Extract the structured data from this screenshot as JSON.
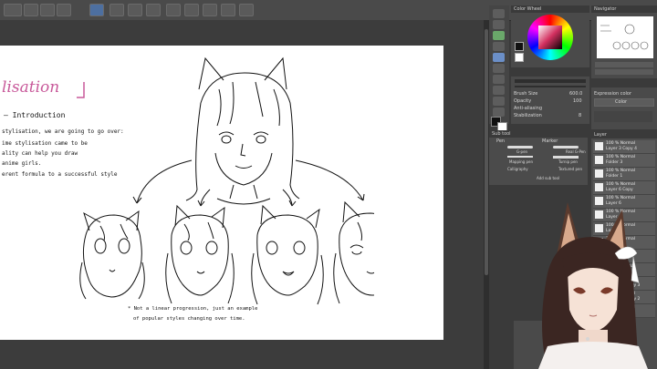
{
  "canvas": {
    "title_fragment": "lisation",
    "section": "— Introduction",
    "lines": [
      "stylisation, we are going to go over:",
      "ime stylisation came to be",
      "ality can help you draw",
      "anime girls.",
      "erent formula to a successful style"
    ],
    "caption_line1": "* Not a linear progression, just an example",
    "caption_line2": "of popular styles changing over time."
  },
  "panels": {
    "color_wheel": "Color Wheel",
    "navigator": "Navigator",
    "brush_size": "Brush Size",
    "brush_size_value": "600.0",
    "opacity": "Opacity",
    "opacity_value": "100",
    "antialiasing": "Anti-aliasing",
    "stabilization": "Stabilization",
    "stabilization_value": "8",
    "expression_color": "Expression color",
    "expression_value": "Color",
    "sub_tool": "Sub tool",
    "pen": "Pen",
    "marker": "Marker",
    "gpen": "G-pen",
    "realgpen": "Real G-Pen",
    "mappingpen": "Mapping pen",
    "turnippen": "Turnip pen",
    "calligraphy": "Calligraphy",
    "texturedpen": "Textured pen",
    "add_subtool": "Add sub tool",
    "layer_panel": "Layer",
    "layers": [
      "100 % Normal\nLayer 3 Copy 4",
      "100 % Normal\nFolder 3",
      "100 % Normal\nFolder 1",
      "100 % Normal\nLayer 6 Copy",
      "100 % Normal\nLayer 6",
      "100 % Normal\nLayer 4",
      "100 % Normal\nLayer 5",
      "100 % Normal\nLayer 3",
      "100 % Normal\nLayer 1",
      "100 % Normal\nLayer 2",
      "100 % Normal\nSketches Copy 3",
      "100 % Normal\nSketches Copy 2",
      "100 % Normal\nLayer 3 Copy"
    ]
  }
}
